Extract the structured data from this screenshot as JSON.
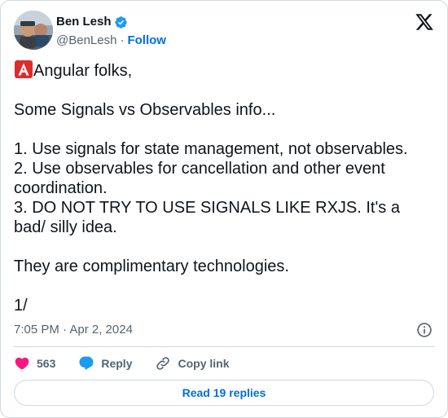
{
  "author": {
    "name": "Ben Lesh",
    "handle": "@BenLesh",
    "separator": "·",
    "follow_label": "Follow"
  },
  "icons": {
    "verified": "verified-badge-icon",
    "platform": "x-logo-icon",
    "emoji": "angular-a-emoji-icon",
    "info": "info-icon",
    "like": "heart-icon",
    "reply": "reply-bubble-icon",
    "copy": "link-icon"
  },
  "tweet": {
    "line_1": "Angular folks,",
    "line_2": "Some Signals vs Observables info...",
    "line_3": "1. Use signals for state management, not observables.",
    "line_4": "2. Use observables for cancellation and other event coordination.",
    "line_5": "3. DO NOT TRY TO USE SIGNALS LIKE RXJS. It's a bad/ silly idea.",
    "line_6": "They are complimentary technologies.",
    "line_7": "1/"
  },
  "meta": {
    "timestamp": "7:05 PM · Apr 2, 2024"
  },
  "actions": {
    "like_count": "563",
    "reply_label": "Reply",
    "copy_label": "Copy link"
  },
  "footer": {
    "read_replies_label": "Read 19 replies"
  },
  "colors": {
    "accent": "#006fd6",
    "verified": "#1d9bf0",
    "like": "#f91880",
    "reply": "#1d9bf0",
    "emoji_bg": "#dd2c2c",
    "muted": "#536471",
    "border": "#cfd9de"
  }
}
